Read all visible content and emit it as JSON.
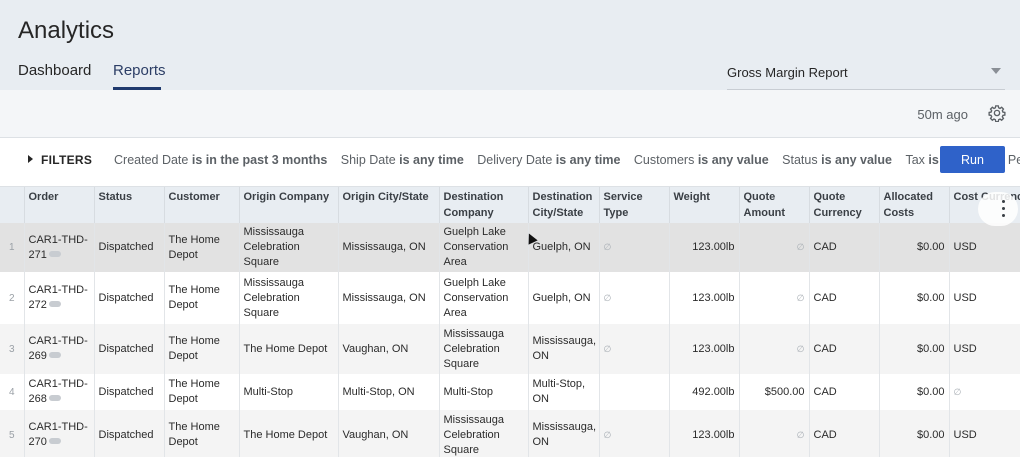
{
  "header": {
    "title": "Analytics",
    "tabs": [
      {
        "label": "Dashboard"
      },
      {
        "label": "Reports",
        "active": true
      }
    ],
    "report_select": {
      "value": "Gross Margin Report"
    }
  },
  "subbar": {
    "updated": "50m ago"
  },
  "filters": {
    "toggle_label": "FILTERS",
    "chips": [
      {
        "field": "Created Date",
        "cond": "is in the past 3 months"
      },
      {
        "field": "Ship Date",
        "cond": "is any time"
      },
      {
        "field": "Delivery Date",
        "cond": "is any time"
      },
      {
        "field": "Customers",
        "cond": "is any value"
      },
      {
        "field": "Status",
        "cond": "is any value"
      },
      {
        "field": "Tax",
        "cond": "is On"
      },
      {
        "field": "Sales Pe",
        "cond": ""
      }
    ],
    "run_label": "Run"
  },
  "table": {
    "columns": [
      "Order",
      "Status",
      "Customer",
      "Origin Company",
      "Origin City/State",
      "Destination Company",
      "Destination City/State",
      "Service Type",
      "Weight",
      "Quote Amount",
      "Quote Currency",
      "Allocated Costs",
      "Cost Currency"
    ],
    "rows": [
      {
        "idx": "1",
        "order": "CAR1-THD-271",
        "status": "Dispatched",
        "customer": "The Home Depot",
        "origin_company": "Mississauga Celebration Square",
        "origin_city": "Mississauga, ON",
        "dest_company": "Guelph Lake Conservation Area",
        "dest_city": "Guelph, ON",
        "service": "∅",
        "weight": "123.00lb",
        "quote_amount": "∅",
        "quote_currency": "CAD",
        "allocated": "$0.00",
        "cost_currency": "USD"
      },
      {
        "idx": "2",
        "order": "CAR1-THD-272",
        "status": "Dispatched",
        "customer": "The Home Depot",
        "origin_company": "Mississauga Celebration Square",
        "origin_city": "Mississauga, ON",
        "dest_company": "Guelph Lake Conservation Area",
        "dest_city": "Guelph, ON",
        "service": "∅",
        "weight": "123.00lb",
        "quote_amount": "∅",
        "quote_currency": "CAD",
        "allocated": "$0.00",
        "cost_currency": "USD"
      },
      {
        "idx": "3",
        "order": "CAR1-THD-269",
        "status": "Dispatched",
        "customer": "The Home Depot",
        "origin_company": "The Home Depot",
        "origin_city": "Vaughan, ON",
        "dest_company": "Mississauga Celebration Square",
        "dest_city": "Mississauga, ON",
        "service": "∅",
        "weight": "123.00lb",
        "quote_amount": "∅",
        "quote_currency": "CAD",
        "allocated": "$0.00",
        "cost_currency": "USD"
      },
      {
        "idx": "4",
        "order": "CAR1-THD-268",
        "status": "Dispatched",
        "customer": "The Home Depot",
        "origin_company": "Multi-Stop",
        "origin_city": "Multi-Stop, ON",
        "dest_company": "Multi-Stop",
        "dest_city": "Multi-Stop, ON",
        "service": "",
        "weight": "492.00lb",
        "quote_amount": "$500.00",
        "quote_currency": "CAD",
        "allocated": "$0.00",
        "cost_currency": "∅"
      },
      {
        "idx": "5",
        "order": "CAR1-THD-270",
        "status": "Dispatched",
        "customer": "The Home Depot",
        "origin_company": "The Home Depot",
        "origin_city": "Vaughan, ON",
        "dest_company": "Mississauga Celebration Square",
        "dest_city": "Mississauga, ON",
        "service": "∅",
        "weight": "123.00lb",
        "quote_amount": "∅",
        "quote_currency": "CAD",
        "allocated": "$0.00",
        "cost_currency": "USD"
      }
    ]
  },
  "icons": {
    "settings": "gear-icon",
    "column_menu": "kebab-menu-icon",
    "row_more": "more-dots-icon",
    "select_caret": "chevron-down-icon",
    "filters_toggle": "caret-right-icon"
  },
  "colors": {
    "accent": "#2f62c9",
    "tab_underline": "#1f3a6e",
    "header_bg": "#e8edf2"
  }
}
